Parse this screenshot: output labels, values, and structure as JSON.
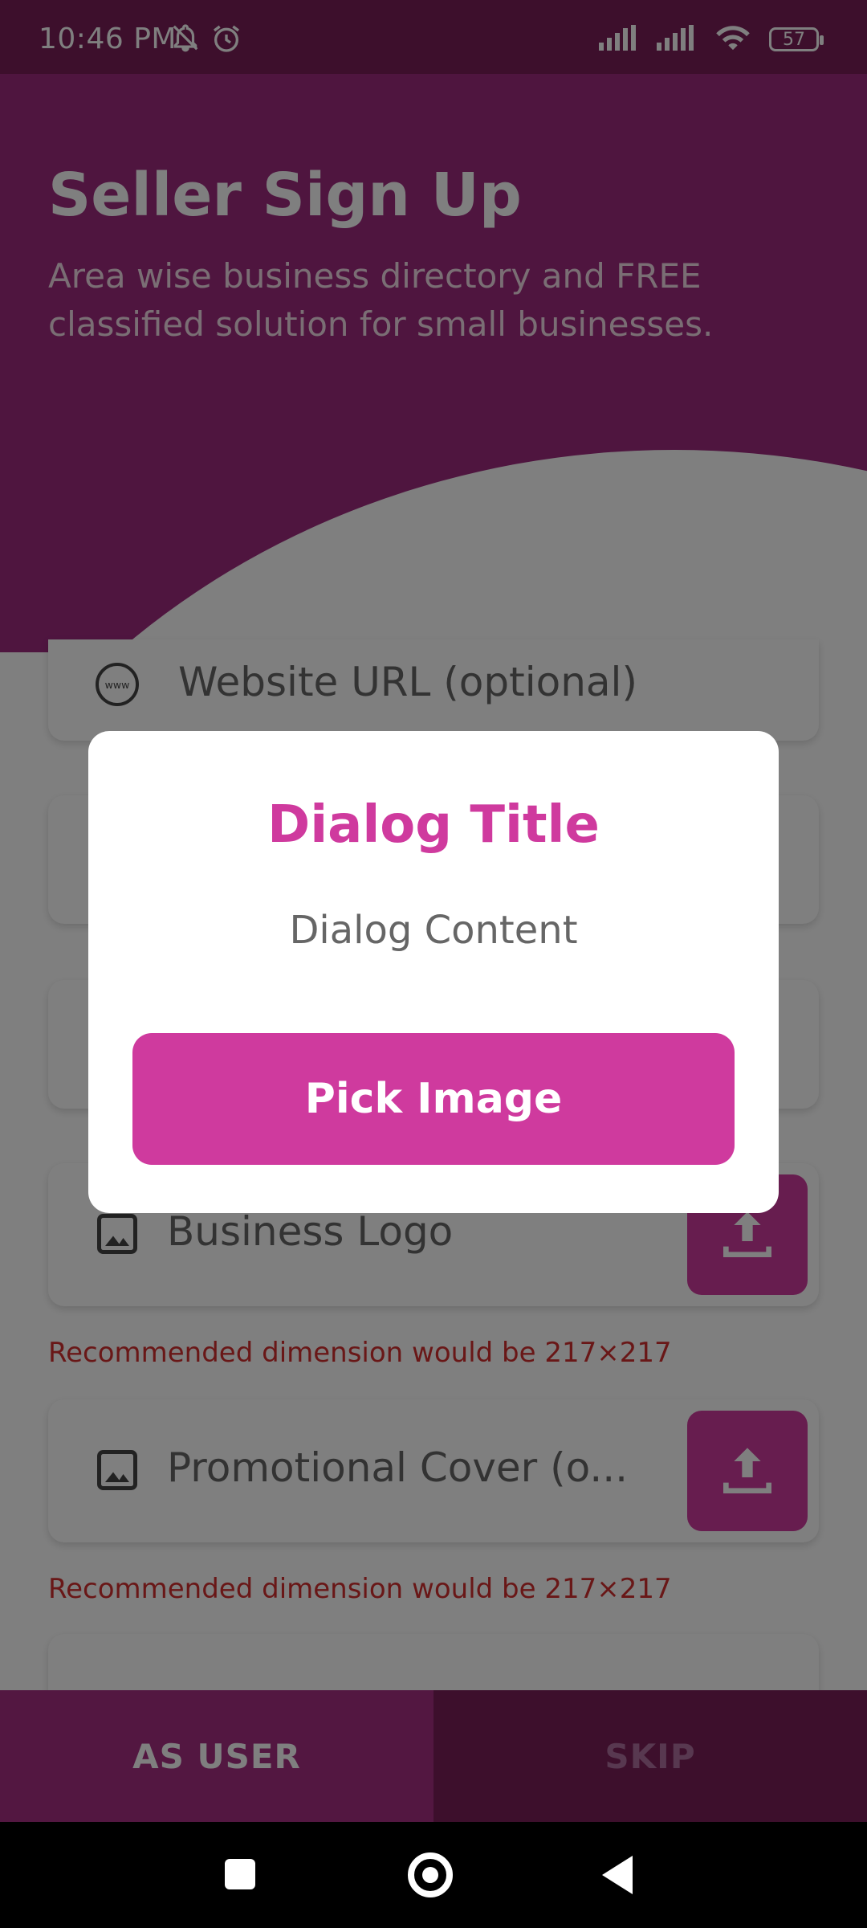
{
  "status_bar": {
    "time": "10:46 PM",
    "battery": "57"
  },
  "header": {
    "title": "Seller Sign Up",
    "subtitle": "Area wise business directory and FREE classified solution for small businesses."
  },
  "form": {
    "website_label": "Website URL  (optional)",
    "logo_label": "Business Logo",
    "cover_label": "Promotional Cover (o...",
    "hint": "Recommended dimension would be 217×217"
  },
  "dialog": {
    "title": "Dialog Title",
    "content": "Dialog Content",
    "button_label": "Pick Image"
  },
  "bottom": {
    "user_label": "AS USER",
    "skip_label": "SKIP"
  },
  "colors": {
    "accent": "#cf3a9e",
    "header_bg": "#9e2a7f",
    "status_bg": "#7a1f58"
  },
  "icons": [
    "bell-off-icon",
    "alarm-icon",
    "signal-icon",
    "wifi-icon",
    "battery-icon",
    "globe-icon",
    "image-icon",
    "upload-icon"
  ]
}
